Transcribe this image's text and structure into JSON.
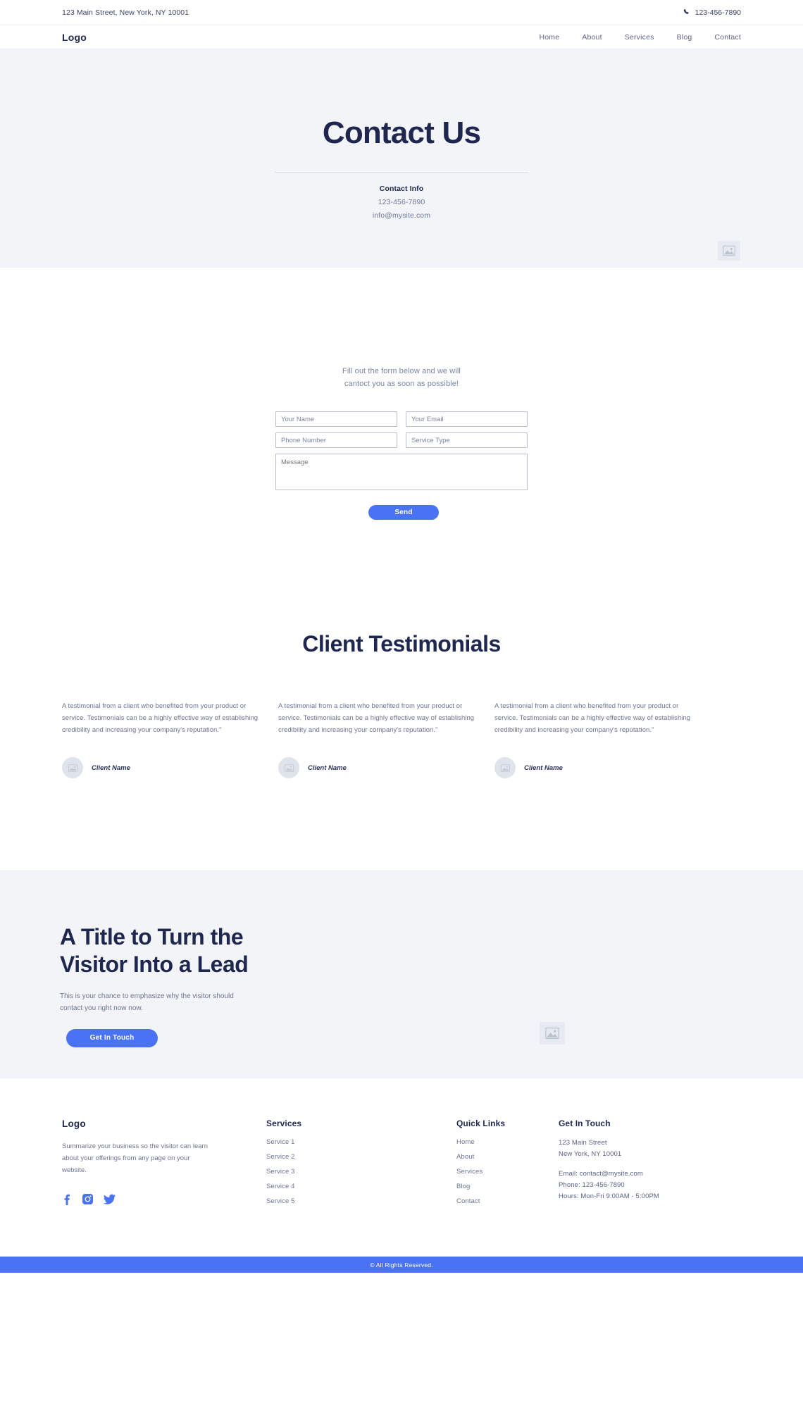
{
  "topbar": {
    "address": "123 Main Street, New York, NY 10001",
    "phone": "123-456-7890",
    "phone_icon": "phone-icon"
  },
  "header": {
    "logo": "Logo",
    "nav": [
      {
        "label": "Home"
      },
      {
        "label": "About"
      },
      {
        "label": "Services"
      },
      {
        "label": "Blog"
      },
      {
        "label": "Contact"
      }
    ]
  },
  "hero": {
    "title": "Contact Us",
    "contact_info_title": "Contact Info",
    "contact_phone": "123-456-7890",
    "contact_email": "info@mysite.com",
    "image_placeholder": "image-placeholder-icon"
  },
  "form": {
    "intro_line_1": "Fill out the form below and we will",
    "intro_line_2": "cantoct you as soon as possible!",
    "name_placeholder": "Your Name",
    "email_placeholder": "Your Email",
    "phone_placeholder": "Phone Number",
    "service_placeholder": "Service Type",
    "message_placeholder": "Message",
    "name_value": "",
    "email_value": "",
    "phone_value": "",
    "service_value": "",
    "message_value": "",
    "send_label": "Send"
  },
  "testimonials": {
    "title": "Client Testimonials",
    "items": [
      {
        "text": "A testimonial from a client who benefited from your product or service. Testimonials can be a highly effective way of establishing credibility and increasing your company's reputation.\"",
        "author": "Client Name",
        "avatar_icon": "image-placeholder-icon"
      },
      {
        "text": "A testimonial from a client who benefited from your product or service. Testimonials can be a highly effective way of establishing credibility and increasing your company's reputation.\"",
        "author": "Client Name",
        "avatar_icon": "image-placeholder-icon"
      },
      {
        "text": "A testimonial from a client who benefited from your product or service. Testimonials can be a highly effective way of establishing credibility and increasing your company's reputation.\"",
        "author": "Client Name",
        "avatar_icon": "image-placeholder-icon"
      }
    ]
  },
  "cta": {
    "title": "A Title to Turn the Visitor Into a Lead",
    "text": "This is your chance to emphasize why the visitor should contact you right now now.",
    "button_label": "Get In Touch",
    "image_placeholder": "image-placeholder-icon"
  },
  "footer": {
    "logo": "Logo",
    "about": "Summarize your business so the visitor can learn about your offerings from any page on your website.",
    "socials": [
      {
        "name": "facebook-icon"
      },
      {
        "name": "instagram-icon"
      },
      {
        "name": "twitter-icon"
      }
    ],
    "services_heading": "Services",
    "services": [
      {
        "label": "Service 1"
      },
      {
        "label": "Service 2"
      },
      {
        "label": "Service 3"
      },
      {
        "label": "Service 4"
      },
      {
        "label": "Service 5"
      }
    ],
    "quicklinks_heading": "Quick Links",
    "quicklinks": [
      {
        "label": "Home"
      },
      {
        "label": "About"
      },
      {
        "label": "Services"
      },
      {
        "label": "Blog"
      },
      {
        "label": "Contact"
      }
    ],
    "touch_heading": "Get In Touch",
    "touch_address_1": "123 Main Street",
    "touch_address_2": "New York, NY 10001",
    "touch_email": "Email: contact@mysite.com",
    "touch_phone": "Phone: 123-456-7890",
    "touch_hours": "Hours: Mon-Fri 9:00AM - 5:00PM",
    "copyright": "© All Rights Reserved."
  },
  "colors": {
    "accent": "#4a72f5",
    "heading": "#1f2750",
    "body_text": "#6b7494",
    "section_bg": "#f3f4f7",
    "placeholder_bg": "#e7eaf0"
  }
}
